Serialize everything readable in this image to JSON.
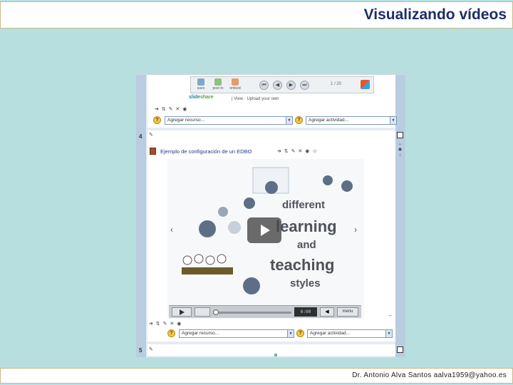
{
  "slide": {
    "title": "Visualizando vídeos",
    "footer": "Dr. Antonio Alva Santos  aalva1959@yahoo.es"
  },
  "embedded": {
    "toolbar": {
      "items": [
        "save",
        "post to",
        "embed"
      ],
      "page": "1 / 20",
      "nav": [
        "⏮",
        "◀",
        "▶",
        "⏭"
      ]
    },
    "slideshare": {
      "logo_a": "slide",
      "logo_b": "share",
      "sub": "| View · Upload your own"
    },
    "edit_icons": "➔ ⇅ ✎ ✕ ◉",
    "dropdowns": {
      "add_resource": "Agregar recurso...",
      "add_activity": "Agregar actividad..."
    },
    "sections": {
      "s4": "4",
      "s5": "5"
    },
    "resource_title": "Ejemplo de configuración de un EDBO",
    "resource_edit_icons": "➔ ⇅ ✎ ✕ ◉ ☺",
    "video": {
      "words": [
        "different",
        "learning",
        "and",
        "teaching",
        "styles"
      ],
      "time": "0:00",
      "menu": "menu",
      "prev_arrow": "‹",
      "next_arrow": "›"
    },
    "side_icons": [
      "↔",
      "◉",
      "↓"
    ]
  }
}
